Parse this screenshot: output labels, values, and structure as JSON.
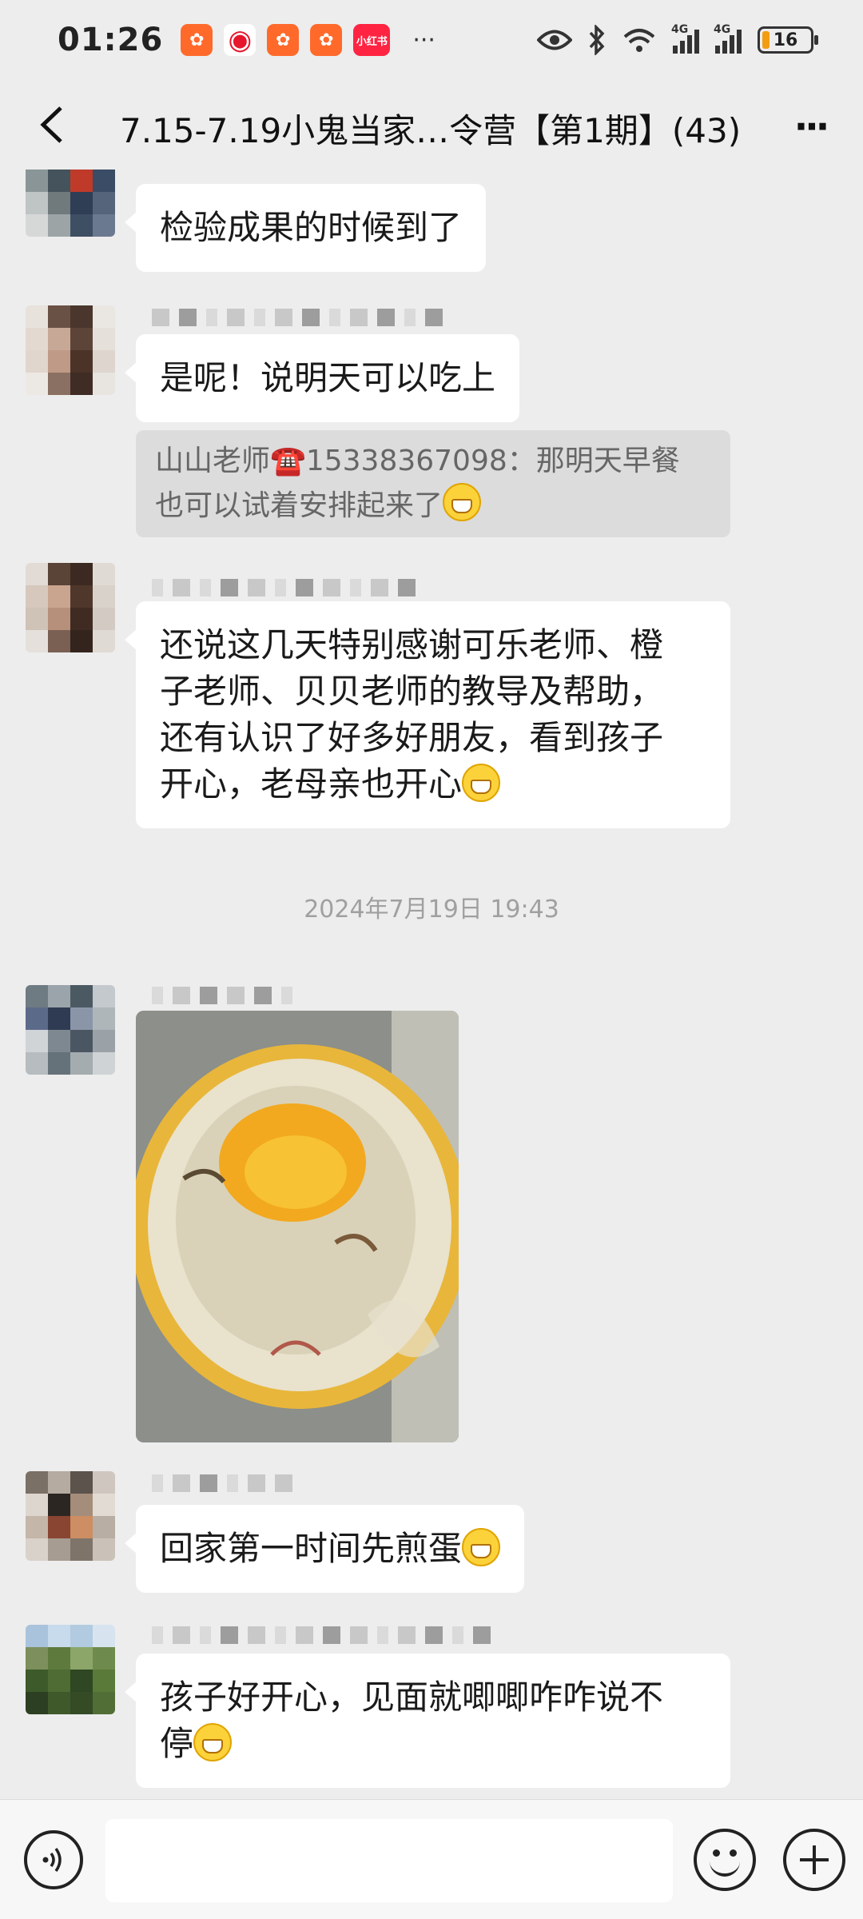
{
  "status_bar": {
    "time": "01:26",
    "app_icons": [
      "app-badge-icon",
      "weibo-icon",
      "app-badge-icon",
      "app-badge-icon",
      "xiaohongshu-icon"
    ],
    "xhs_label": "小红书",
    "more": "···",
    "network_1": "4G",
    "network_2": "4G",
    "battery": "16",
    "battery_level": 0.16
  },
  "header": {
    "title": "7.15-7.19小鬼当家…令营【第1期】(43)",
    "more": "···"
  },
  "messages": [
    {
      "type": "text",
      "text": "检验成果的时候到了"
    },
    {
      "type": "text",
      "text": "是呢！说明天可以吃上"
    },
    {
      "type": "quote",
      "line1": "山山老师☎️15338367098：那明天早餐",
      "line2": "也可以试着安排起来了"
    },
    {
      "type": "text",
      "lines": [
        "还说这几天特别感谢可乐老师、橙",
        "子老师、贝贝老师的教导及帮助，",
        "还有认识了好多好朋友，看到孩子",
        "开心，老母亲也开心"
      ]
    },
    {
      "type": "timestamp",
      "text": "2024年7月19日 19:43"
    },
    {
      "type": "image",
      "alt": "plate-photo"
    },
    {
      "type": "text",
      "text": "回家第一时间先煎蛋"
    },
    {
      "type": "text",
      "lines": [
        "孩子好开心，见面就唧唧咋咋说不",
        "停"
      ]
    }
  ],
  "input_bar": {
    "placeholder": ""
  }
}
